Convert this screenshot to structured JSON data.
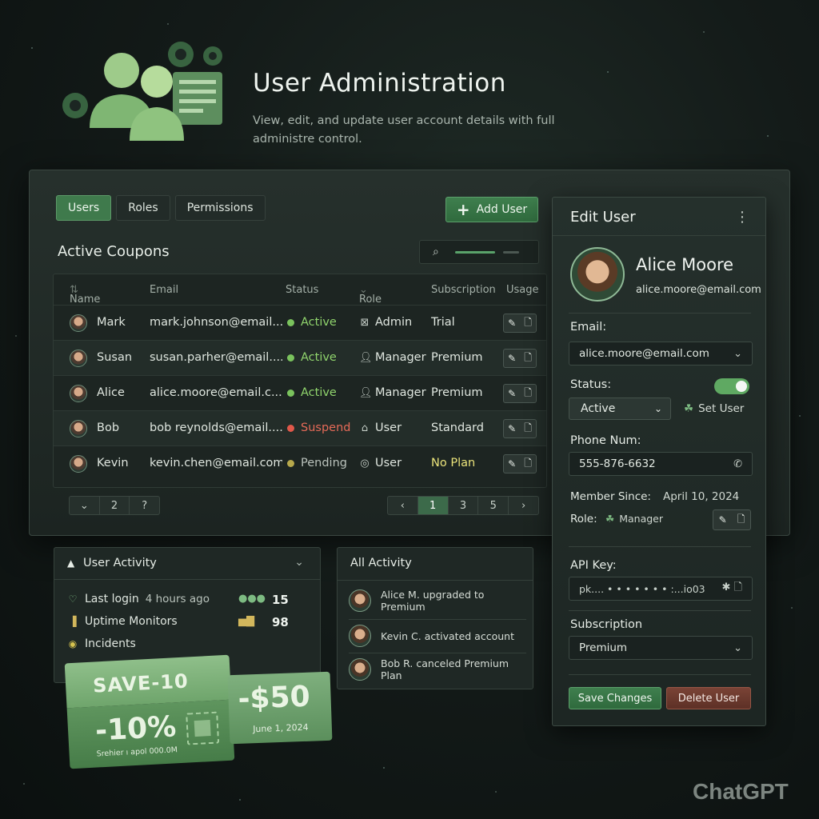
{
  "header": {
    "title": "User Administration",
    "subtitle": "View, edit, and update user account details with full administre control."
  },
  "tabs": [
    {
      "label": "Users",
      "active": true
    },
    {
      "label": "Roles",
      "active": false
    },
    {
      "label": "Permissions",
      "active": false
    }
  ],
  "add_user_label": "Add User",
  "table": {
    "title": "Active Coupons",
    "columns": [
      "Name",
      "Email",
      "Status",
      "Role",
      "Subscription",
      "Usage"
    ],
    "rows": [
      {
        "name": "Mark",
        "email": "mark.johnson@email....",
        "status": "Active",
        "status_color": "#7ac35d",
        "role": "Admin",
        "role_icon": "admin-icon",
        "subscription": "Trial"
      },
      {
        "name": "Susan",
        "email": "susan.parher@email....",
        "status": "Active",
        "status_color": "#7ac35d",
        "role": "Manager",
        "role_icon": "person-icon",
        "subscription": "Premium"
      },
      {
        "name": "Alice",
        "email": "alice.moore@email.c...",
        "status": "Active",
        "status_color": "#7ac35d",
        "role": "Manager",
        "role_icon": "person-icon",
        "subscription": "Premium"
      },
      {
        "name": "Bob",
        "email": "bob reynolds@email....",
        "status": "Suspend",
        "status_color": "#e0584a",
        "role": "User",
        "role_icon": "home-icon",
        "subscription": "Standard"
      },
      {
        "name": "Kevin",
        "email": "kevin.chen@email.com",
        "status": "Pending",
        "status_color": "#b7a94c",
        "role": "User",
        "role_icon": "circle-icon",
        "subscription": "No Plan"
      }
    ],
    "pager_left": [
      "⌄",
      "2",
      "?"
    ],
    "pager_right": [
      "‹",
      "1",
      "3",
      "5",
      "›"
    ],
    "current_page": "1"
  },
  "edit_user": {
    "title": "Edit User",
    "name": "Alice Moore",
    "email": "alice.moore@email.com",
    "email_label": "Email:",
    "email_value": "alice.moore@email.com",
    "status_label": "Status:",
    "status_value": "Active",
    "status_enabled": true,
    "set_user_label": "Set User",
    "phone_label": "Phone Num:",
    "phone_value": "555-876-6632",
    "member_since_label": "Member Since:",
    "member_since_value": "April 10, 2024",
    "role_label": "Role:",
    "role_value": "Manager",
    "api_key_label": "API Key:",
    "api_key_value": "pk.... • • • • • • • :...io03",
    "subscription_label": "Subscription",
    "subscription_value": "Premium",
    "save_label": "Save Changes",
    "delete_label": "Delete User"
  },
  "user_activity": {
    "title": "User Activity",
    "last_login_label": "Last login",
    "last_login_value": "4 hours ago",
    "last_login_count": "15",
    "uptime_label": "Uptime Monitors",
    "uptime_count": "98",
    "incidents_label": "Incidents"
  },
  "all_activity": {
    "title": "All Activity",
    "items": [
      "Alice M. upgraded to Premium",
      "Kevin C. activated account",
      "Bob R. canceled Premium Plan"
    ]
  },
  "coupons": {
    "coupon1_code": "SAVE-10",
    "coupon1_discount": "-10%",
    "coupon1_fine": "Srehier ı apol 000.0M",
    "coupon2_amount": "-$50",
    "coupon2_date": "June 1, 2024"
  },
  "watermark": "ChatGPT",
  "colors": {
    "accent": "#3f7a4c",
    "active": "#7ac35d",
    "suspend": "#e0584a",
    "pending": "#b7a94c",
    "delete": "#7a4336"
  }
}
